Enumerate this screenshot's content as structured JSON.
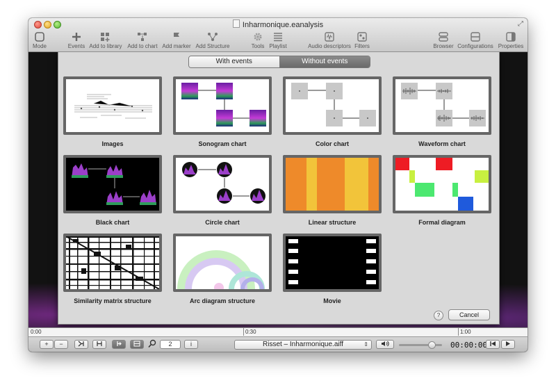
{
  "window": {
    "title": "Inharmonique.eanalysis"
  },
  "toolbar": [
    {
      "label": "Mode",
      "icon": "mode-icon"
    },
    {
      "label": "Events",
      "icon": "plus-icon"
    },
    {
      "label": "Add to library",
      "icon": "library-icon"
    },
    {
      "label": "Add to chart",
      "icon": "chart-icon"
    },
    {
      "label": "Add marker",
      "icon": "marker-icon"
    },
    {
      "label": "Add Structure",
      "icon": "structure-icon"
    },
    {
      "label": "Tools",
      "icon": "gear-icon"
    },
    {
      "label": "Playlist",
      "icon": "list-icon"
    },
    {
      "label": "Audio descriptors",
      "icon": "waveform-icon"
    },
    {
      "label": "Filters",
      "icon": "filter-icon"
    },
    {
      "label": "Browser",
      "icon": "browser-icon"
    },
    {
      "label": "Configurations",
      "icon": "configurations-icon"
    },
    {
      "label": "Properties",
      "icon": "properties-icon"
    }
  ],
  "sheet": {
    "segments": [
      "With events",
      "Without events"
    ],
    "selected_segment": "Without events",
    "templates": [
      {
        "label": "Images"
      },
      {
        "label": "Sonogram chart"
      },
      {
        "label": "Color chart"
      },
      {
        "label": "Waveform chart"
      },
      {
        "label": "Black chart"
      },
      {
        "label": "Circle chart"
      },
      {
        "label": "Linear structure"
      },
      {
        "label": "Formal diagram"
      },
      {
        "label": "Similarity matrix structure"
      },
      {
        "label": "Arc diagram structure"
      },
      {
        "label": "Movie"
      }
    ],
    "help_label": "?",
    "cancel_label": "Cancel"
  },
  "timeline": {
    "ticks": [
      "0:00",
      "0:30",
      "1:00"
    ]
  },
  "bottombar": {
    "plus_label": "+",
    "minus_label": "−",
    "page_value": "2",
    "info_label": "i",
    "audio_file": "Risset – Inharmonique.aiff",
    "timecode": "00:00:00",
    "volume_level": 0.75
  },
  "colors": {
    "linear_structure": [
      "#ee8a2a",
      "#f2c43a"
    ],
    "accent_purple": "#9b3fc9"
  }
}
